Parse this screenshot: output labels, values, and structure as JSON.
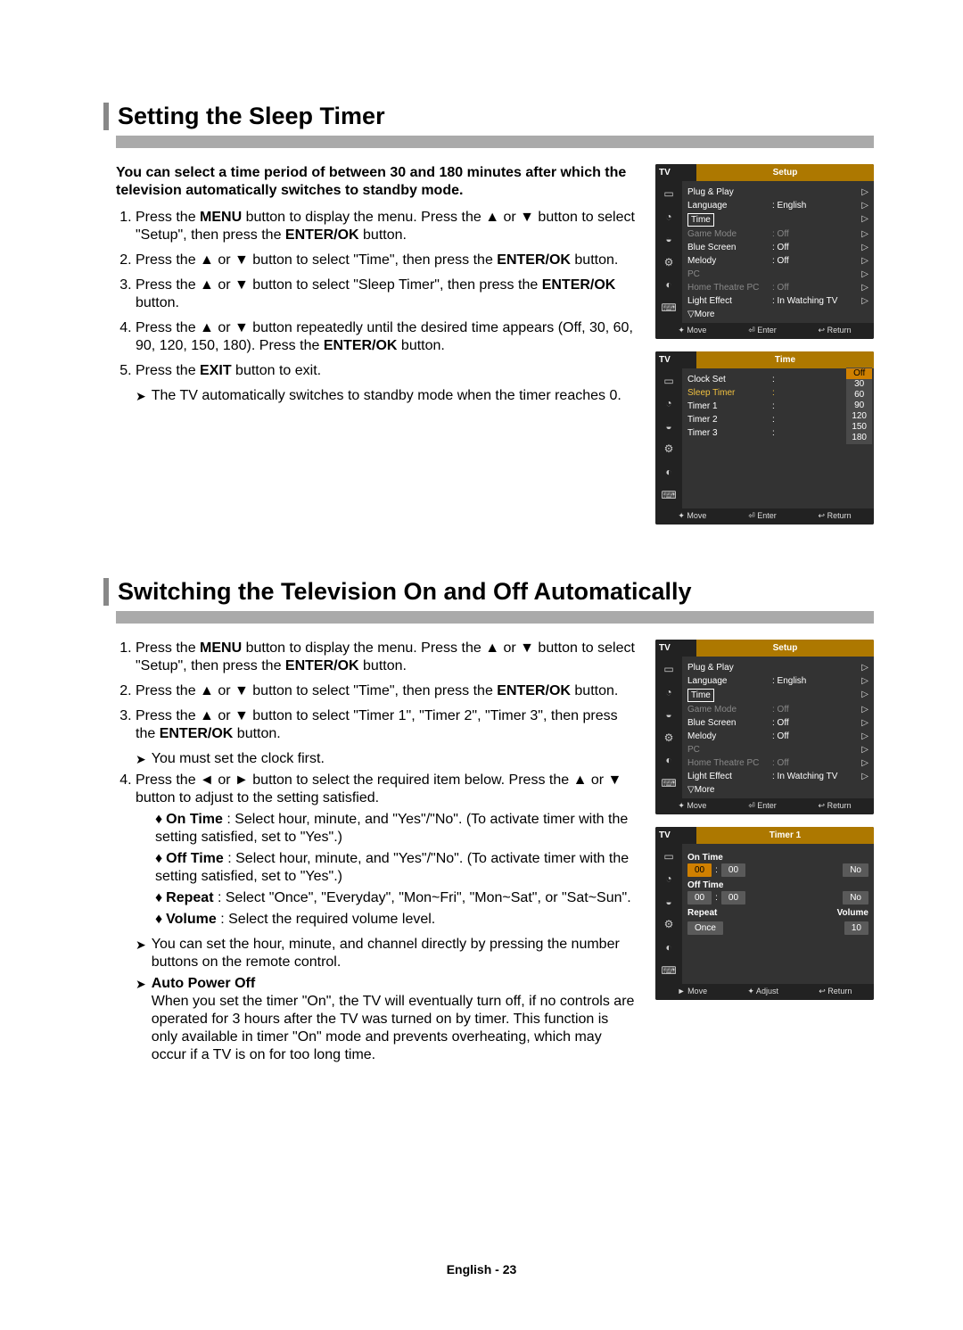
{
  "section1": {
    "title": "Setting the Sleep Timer",
    "intro": "You can select a time period of between 30 and 180 minutes after which the television automatically switches to standby mode.",
    "steps": [
      "Press the <b>MENU</b> button to display the menu. Press the ▲ or ▼ button to select \"Setup\", then press the <b>ENTER/OK</b> button.",
      "Press the ▲ or ▼ button to select \"Time\", then press the <b>ENTER/OK</b> button.",
      "Press the ▲ or ▼ button to select \"Sleep Timer\", then press the <b>ENTER/OK</b> button.",
      "Press the ▲ or ▼ button repeatedly until the desired time appears (Off, 30, 60, 90, 120, 150, 180). Press the <b>ENTER/OK</b> button.",
      "Press the <b>EXIT</b> button to exit."
    ],
    "note": "The TV automatically switches to standby mode when the timer reaches 0."
  },
  "section2": {
    "title": "Switching the Television On and Off Automatically",
    "steps": [
      "Press the <b>MENU</b> button to display the menu. Press the ▲ or ▼ button to select \"Setup\", then press the <b>ENTER/OK</b> button.",
      "Press the ▲ or ▼ button to select \"Time\", then press the <b>ENTER/OK</b> button.",
      "Press the ▲ or ▼ button to select \"Timer 1\", \"Timer 2\", \"Timer 3\", then press the <b>ENTER/OK</b> button."
    ],
    "note_clock": "You must set the clock first.",
    "step4_lead": "Press the ◄ or ► button to select the required item below. Press the ▲ or ▼ button to adjust to the setting satisfied.",
    "bullets": [
      "<b>On Time</b> : Select hour, minute, and \"Yes\"/\"No\". (To activate timer with the setting satisfied, set to \"Yes\".)",
      "<b>Off Time</b> : Select hour, minute, and \"Yes\"/\"No\". (To activate timer with the setting satisfied, set to \"Yes\".)",
      "<b>Repeat</b> : Select \"Once\", \"Everyday\", \"Mon~Fri\", \"Mon~Sat\", or \"Sat~Sun\".",
      "<b>Volume</b> : Select the required volume level."
    ],
    "note_remote": "You can set the hour, minute, and channel directly by pressing the number buttons on the remote control.",
    "auto_power_title": "Auto Power Off",
    "auto_power_body": "When you set the timer \"On\", the TV will eventually turn off, if no controls are operated for 3 hours after the TV was turned on by timer. This function is only available in timer \"On\" mode and prevents overheating, which may occur if a TV is on for too long time."
  },
  "osd_setup": {
    "tv": "TV",
    "title": "Setup",
    "rows": [
      {
        "label": "Plug & Play",
        "value": "",
        "arrow": "▷"
      },
      {
        "label": "Language",
        "value": ": English",
        "arrow": "▷"
      },
      {
        "label": "Time",
        "boxed": true,
        "arrow": "▷"
      },
      {
        "label": "Game Mode",
        "value": ": Off",
        "dim": true,
        "arrow": "▷"
      },
      {
        "label": "Blue Screen",
        "value": ": Off",
        "arrow": "▷"
      },
      {
        "label": "Melody",
        "value": ": Off",
        "arrow": "▷"
      },
      {
        "label": "PC",
        "dim": true,
        "arrow": "▷"
      },
      {
        "label": "Home Theatre PC",
        "value": ": Off",
        "dim": true,
        "arrow": "▷"
      },
      {
        "label": "Light Effect",
        "value": ": In Watching TV",
        "arrow": "▷"
      },
      {
        "label": "▽More",
        "value": ""
      }
    ],
    "footer": [
      "✦ Move",
      "⏎ Enter",
      "↩ Return"
    ]
  },
  "osd_time": {
    "tv": "TV",
    "title": "Time",
    "rows": [
      {
        "label": "Clock Set",
        "value": ":"
      },
      {
        "label": "Sleep Timer",
        "value": ":",
        "hl": true
      },
      {
        "label": "Timer 1",
        "value": ":"
      },
      {
        "label": "Timer 2",
        "value": ":"
      },
      {
        "label": "Timer 3",
        "value": ":"
      }
    ],
    "options": [
      "Off",
      "30",
      "60",
      "90",
      "120",
      "150",
      "180"
    ],
    "options_selected": "Off",
    "footer": [
      "✦ Move",
      "⏎ Enter",
      "↩ Return"
    ]
  },
  "osd_timer1": {
    "tv": "TV",
    "title": "Timer 1",
    "on_time": {
      "label": "On Time",
      "h": "00",
      "m": "00",
      "state": "No"
    },
    "off_time": {
      "label": "Off Time",
      "h": "00",
      "m": "00",
      "state": "No"
    },
    "repeat": {
      "label": "Repeat",
      "value": "Once"
    },
    "volume": {
      "label": "Volume",
      "value": "10"
    },
    "footer": [
      "► Move",
      "✦ Adjust",
      "↩ Return"
    ]
  },
  "icons": [
    "▭",
    "◔",
    "◒",
    "⚙",
    "◐",
    "⌨"
  ],
  "page_footer": "English - 23"
}
